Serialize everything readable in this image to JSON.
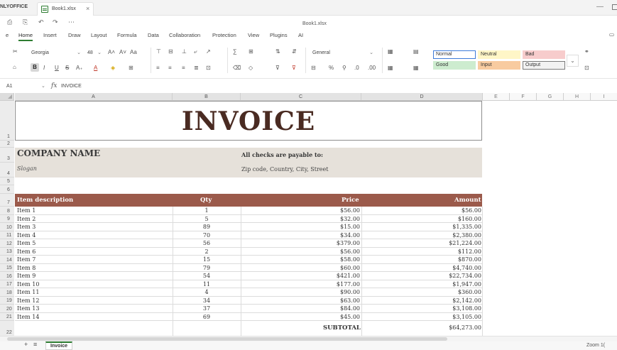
{
  "app": {
    "name": "NLYOFFICE",
    "tab_file": "Book1.xlsx",
    "file_title": "Book1.xlsx"
  },
  "menu": {
    "items": [
      "e",
      "Home",
      "Insert",
      "Draw",
      "Layout",
      "Formula",
      "Data",
      "Collaboration",
      "Protection",
      "View",
      "Plugins",
      "AI"
    ],
    "active": "Home"
  },
  "ribbon": {
    "font_name": "Georgia",
    "font_size": "48",
    "number_format": "General",
    "styles": [
      {
        "label": "Normal",
        "bg": "#ffffff",
        "border": "#3d7bd9"
      },
      {
        "label": "Neutral",
        "bg": "#fff6c7",
        "border": "#fff6c7"
      },
      {
        "label": "Bad",
        "bg": "#f7cccc",
        "border": "#f7cccc"
      },
      {
        "label": "Good",
        "bg": "#cdeccf",
        "border": "#cdeccf"
      },
      {
        "label": "Input",
        "bg": "#f8cba0",
        "border": "#f8cba0"
      },
      {
        "label": "Output",
        "bg": "#f2f2f2",
        "border": "#7b7b7b"
      }
    ]
  },
  "formula_bar": {
    "cell_ref": "A1",
    "value": "INVOICE"
  },
  "columns": [
    "A",
    "B",
    "C",
    "D",
    "E",
    "F",
    "G",
    "H",
    "I"
  ],
  "rows_header": [
    "1",
    "2",
    "3",
    "4",
    "5",
    "6",
    "7",
    "8",
    "9",
    "10",
    "11",
    "12",
    "13",
    "14",
    "15",
    "16",
    "17",
    "18",
    "19",
    "20",
    "21",
    "22"
  ],
  "invoice": {
    "title": "INVOICE",
    "company": "COMPANY NAME",
    "slogan": "Slogan",
    "payable": "All checks are payable to:",
    "address": "Zip code, Country, City, Street",
    "headers": [
      "Item description",
      "Qty",
      "Price",
      "Amount"
    ],
    "items": [
      {
        "desc": "Item 1",
        "qty": "1",
        "price": "$56.00",
        "amount": "$56.00"
      },
      {
        "desc": "Item 2",
        "qty": "5",
        "price": "$32.00",
        "amount": "$160.00"
      },
      {
        "desc": "Item 3",
        "qty": "89",
        "price": "$15.00",
        "amount": "$1,335.00"
      },
      {
        "desc": "Item 4",
        "qty": "70",
        "price": "$34.00",
        "amount": "$2,380.00"
      },
      {
        "desc": "Item 5",
        "qty": "56",
        "price": "$379.00",
        "amount": "$21,224.00"
      },
      {
        "desc": "Item 6",
        "qty": "2",
        "price": "$56.00",
        "amount": "$112.00"
      },
      {
        "desc": "Item 7",
        "qty": "15",
        "price": "$58.00",
        "amount": "$870.00"
      },
      {
        "desc": "Item 8",
        "qty": "79",
        "price": "$60.00",
        "amount": "$4,740.00"
      },
      {
        "desc": "Item 9",
        "qty": "54",
        "price": "$421.00",
        "amount": "$22,734.00"
      },
      {
        "desc": "Item 10",
        "qty": "11",
        "price": "$177.00",
        "amount": "$1,947.00"
      },
      {
        "desc": "Item 11",
        "qty": "4",
        "price": "$90.00",
        "amount": "$360.00"
      },
      {
        "desc": "Item 12",
        "qty": "34",
        "price": "$63.00",
        "amount": "$2,142.00"
      },
      {
        "desc": "Item 13",
        "qty": "37",
        "price": "$84.00",
        "amount": "$3,108.00"
      },
      {
        "desc": "Item 14",
        "qty": "69",
        "price": "$45.00",
        "amount": "$3,105.00"
      }
    ],
    "subtotal_label": "SUBTOTAL",
    "subtotal_value": "$64,273.00"
  },
  "sheet": {
    "tab": "Invoice",
    "zoom": "Zoom 1("
  },
  "colors": {
    "accent": "#2e7d32",
    "header_band": "#9b5a4b",
    "info_band": "#e6e1da",
    "title_text": "#4a2b22"
  }
}
